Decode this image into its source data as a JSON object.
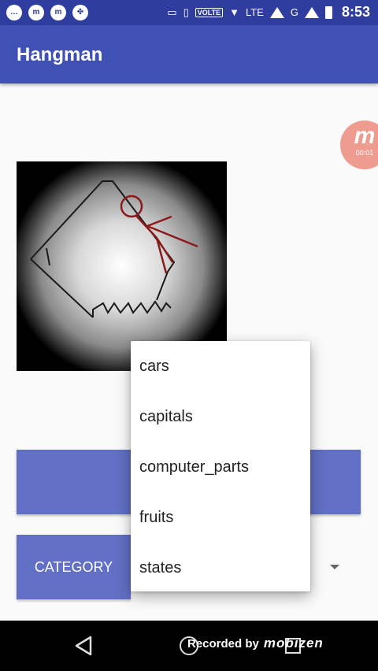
{
  "status_bar": {
    "time": "8:53",
    "volte": "VOLTE",
    "lte": "LTE",
    "g": "G"
  },
  "app": {
    "title": "Hangman"
  },
  "recording_badge": {
    "logo": "m",
    "elapsed": "00:01"
  },
  "category_button": {
    "label": "CATEGORY"
  },
  "dropdown": {
    "items": [
      "cars",
      "capitals",
      "computer_parts",
      "fruits",
      "states"
    ]
  },
  "nav": {
    "recorded_by": "Recorded by",
    "brand": "mobizen"
  },
  "colors": {
    "status_bar": "#2f3e9e",
    "app_bar": "#3f51b5",
    "button": "#6170c4",
    "hangman_stroke": "#8b1a1a"
  },
  "icons": [
    "back-icon",
    "home-icon",
    "recents-icon",
    "wifi-icon",
    "signal-icon",
    "battery-icon",
    "cast-icon",
    "vibrate-icon"
  ]
}
